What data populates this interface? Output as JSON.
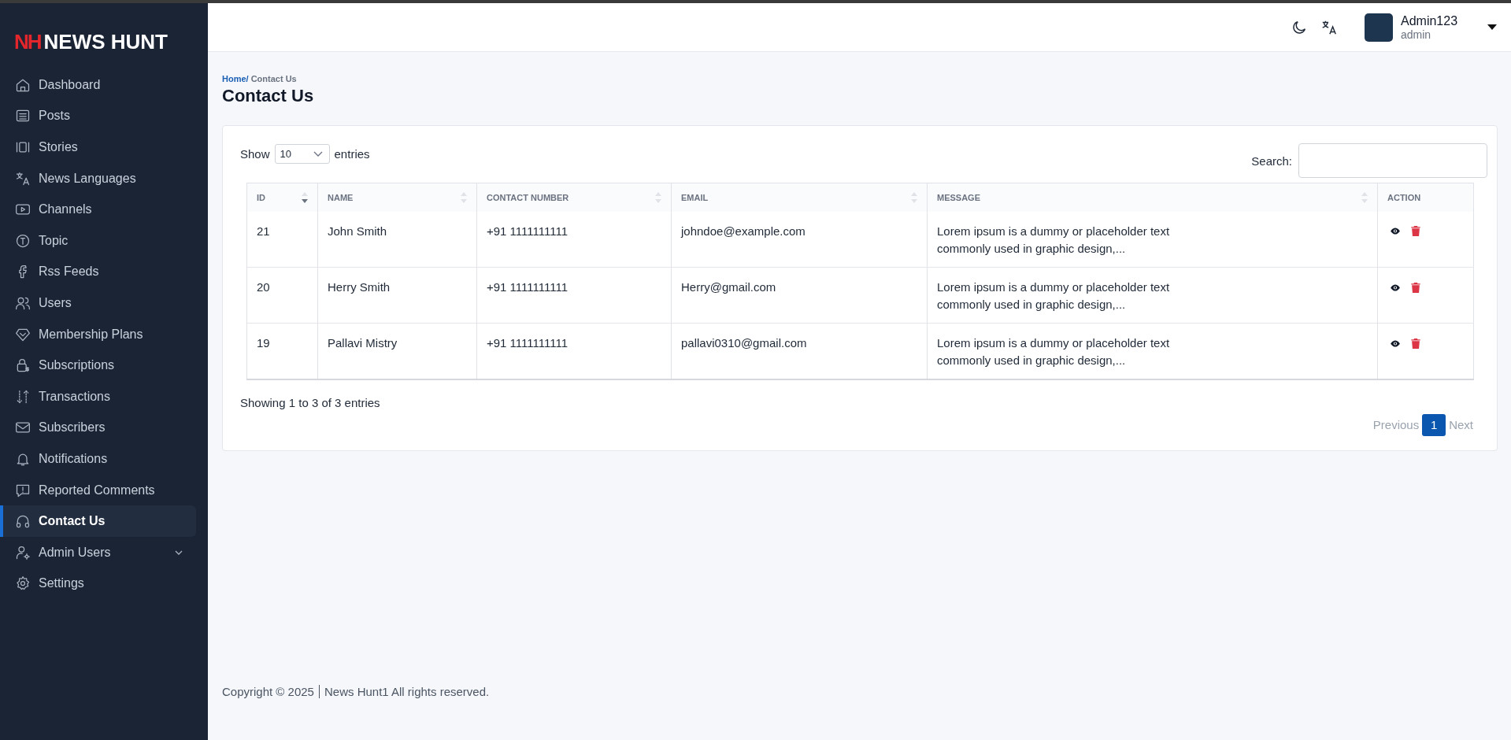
{
  "logo": {
    "mark": "NH",
    "text": "NEWS HUNT"
  },
  "sidebar": {
    "items": [
      {
        "label": "Dashboard",
        "selected": false
      },
      {
        "label": "Posts",
        "selected": false
      },
      {
        "label": "Stories",
        "selected": false
      },
      {
        "label": "News Languages",
        "selected": false
      },
      {
        "label": "Channels",
        "selected": false
      },
      {
        "label": "Topic",
        "selected": false
      },
      {
        "label": "Rss Feeds",
        "selected": false
      },
      {
        "label": "Users",
        "selected": false
      },
      {
        "label": "Membership Plans",
        "selected": false
      },
      {
        "label": "Subscriptions",
        "selected": false
      },
      {
        "label": "Transactions",
        "selected": false
      },
      {
        "label": "Subscribers",
        "selected": false
      },
      {
        "label": "Notifications",
        "selected": false
      },
      {
        "label": "Reported Comments",
        "selected": false
      },
      {
        "label": "Contact Us",
        "selected": true
      },
      {
        "label": "Admin Users",
        "selected": false,
        "expanded": false
      },
      {
        "label": "Settings",
        "selected": false
      }
    ]
  },
  "header": {
    "user": {
      "name": "Admin123",
      "role": "admin"
    }
  },
  "breadcrumb": {
    "home": "Home/",
    "current": "Contact Us"
  },
  "page_title": "Contact Us",
  "table_controls": {
    "show_label": "Show",
    "page_size": "10",
    "entries_label": "entries",
    "search_label": "Search:"
  },
  "table": {
    "columns": [
      {
        "label": "ID",
        "sortable": true,
        "sorted": true
      },
      {
        "label": "NAME",
        "sortable": true,
        "sorted": false
      },
      {
        "label": "CONTACT NUMBER",
        "sortable": true,
        "sorted": false
      },
      {
        "label": "EMAIL",
        "sortable": true,
        "sorted": false
      },
      {
        "label": "MESSAGE",
        "sortable": true,
        "sorted": false
      },
      {
        "label": "ACTION"
      }
    ],
    "rows": [
      {
        "id": "21",
        "name": "John Smith",
        "contact": "+91 1111111111",
        "email": "johndoe@example.com",
        "message": "Lorem ipsum is a dummy or placeholder text commonly used in graphic design,..."
      },
      {
        "id": "20",
        "name": "Herry Smith",
        "contact": "+91 1111111111",
        "email": "Herry@gmail.com",
        "message": "Lorem ipsum is a dummy or placeholder text commonly used in graphic design,..."
      },
      {
        "id": "19",
        "name": "Pallavi Mistry",
        "contact": "+91 1111111111",
        "email": "pallavi0310@gmail.com",
        "message": "Lorem ipsum is a dummy or placeholder text commonly used in graphic design,..."
      }
    ]
  },
  "table_info": "Showing 1 to 3 of 3 entries",
  "pagination": {
    "previous": {
      "label": "Previous",
      "disabled": true
    },
    "pages": [
      {
        "label": "1",
        "selected": true
      }
    ],
    "next": {
      "label": "Next",
      "disabled": true
    }
  },
  "footer": {
    "copyright": "Copyright © 2025",
    "site": "News Hunt1 All rights reserved."
  }
}
